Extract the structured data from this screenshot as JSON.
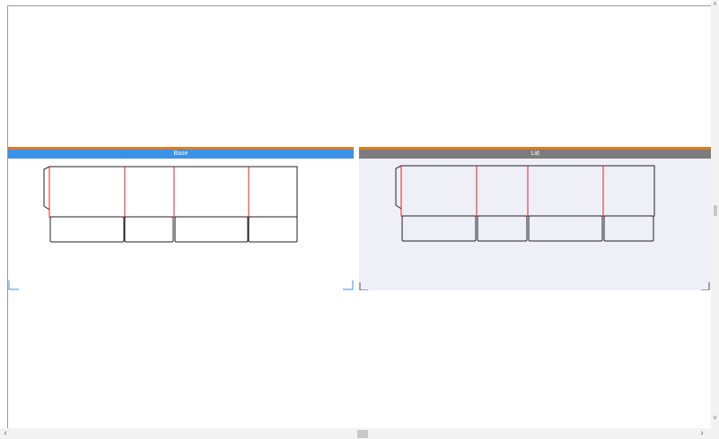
{
  "canvas": {
    "panels": [
      {
        "id": "base",
        "title": "Base",
        "state": "selected",
        "title_color": "#3a92e8"
      },
      {
        "id": "lid",
        "title": "Lid",
        "state": "unselected",
        "title_color": "#7c7c7c"
      }
    ],
    "colors": {
      "accent_line": "#e07a1f",
      "cut_line": "#222222",
      "fold_line": "#e02020",
      "lid_background": "#efeff8",
      "selection_corner": "#3a92e8"
    }
  },
  "scrollbars": {
    "horizontal": {
      "left_arrow": "‹",
      "right_arrow": "›"
    },
    "vertical": {
      "up_arrow": "˄",
      "down_arrow": "˅"
    }
  }
}
